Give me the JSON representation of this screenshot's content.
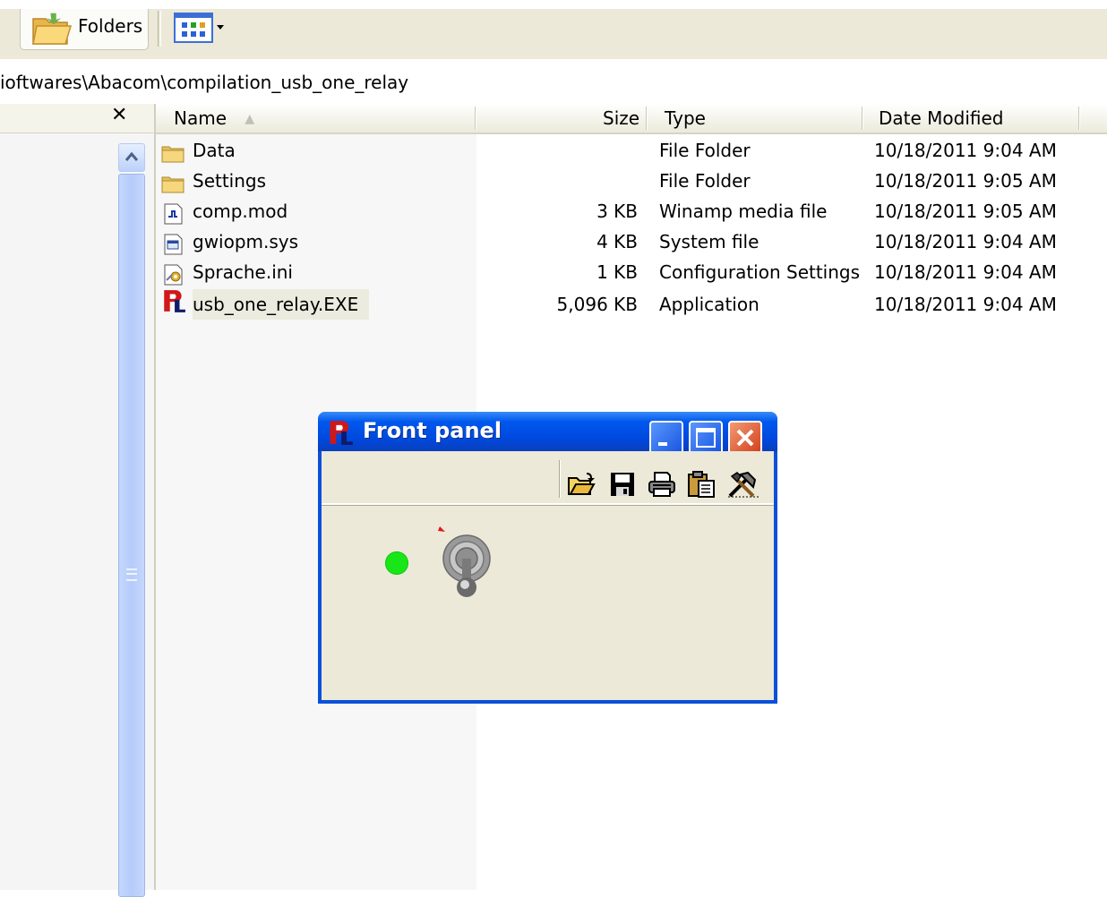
{
  "toolbar": {
    "folders_label": "Folders",
    "folders_icon": "folder-open-icon",
    "views_icon": "views-grid-icon"
  },
  "address": {
    "path": "ioftwares\\Abacom\\compilation_usb_one_relay"
  },
  "left_pane": {
    "close_glyph": "✕"
  },
  "columns": {
    "name": "Name",
    "size": "Size",
    "type": "Type",
    "date": "Date Modified",
    "sort_indicator": "▲"
  },
  "files": [
    {
      "name": "Data",
      "size": "",
      "type": "File Folder",
      "date": "10/18/2011 9:04 AM",
      "icon": "folder-icon"
    },
    {
      "name": "Settings",
      "size": "",
      "type": "File Folder",
      "date": "10/18/2011 9:05 AM",
      "icon": "folder-icon"
    },
    {
      "name": "comp.mod",
      "size": "3 KB",
      "type": "Winamp media file",
      "date": "10/18/2011 9:05 AM",
      "icon": "media-file-icon"
    },
    {
      "name": "gwiopm.sys",
      "size": "4 KB",
      "type": "System file",
      "date": "10/18/2011 9:04 AM",
      "icon": "system-file-icon"
    },
    {
      "name": "Sprache.ini",
      "size": "1 KB",
      "type": "Configuration Settings",
      "date": "10/18/2011 9:04 AM",
      "icon": "settings-file-icon"
    },
    {
      "name": "usb_one_relay.EXE",
      "size": "5,096 KB",
      "type": "Application",
      "date": "10/18/2011 9:04 AM",
      "icon": "profilab-app-icon"
    }
  ],
  "front_panel": {
    "title": "Front panel",
    "toolbar_icons": [
      "open-folder-icon",
      "save-icon",
      "print-icon",
      "paste-icon",
      "tools-icon"
    ],
    "led_color": "#19e619",
    "switch_state": "off"
  }
}
